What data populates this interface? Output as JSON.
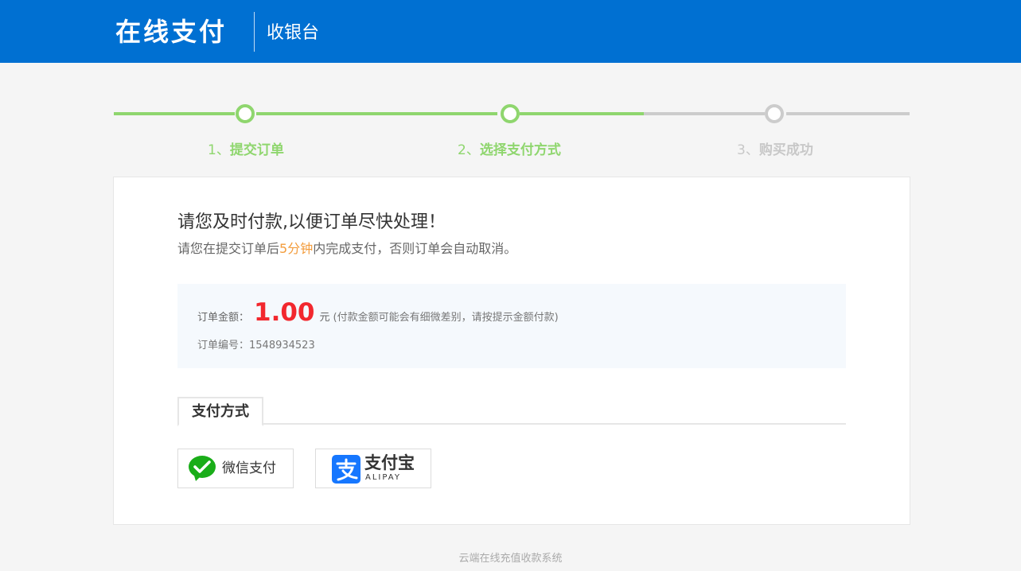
{
  "header": {
    "brand": "在线支付",
    "subtitle": "收银台"
  },
  "steps": [
    {
      "num": "1、",
      "label": "提交订单",
      "state": "done"
    },
    {
      "num": "2、",
      "label": "选择支付方式",
      "state": "done"
    },
    {
      "num": "3、",
      "label": "购买成功",
      "state": "pending"
    }
  ],
  "notice": {
    "title": "请您及时付款,以便订单尽快处理！",
    "sub_before": "请您在提交订单后",
    "sub_highlight": "5分钟",
    "sub_after": "内完成支付，否则订单会自动取消。"
  },
  "order": {
    "amount_label": "订单金额：",
    "amount_value": "1.00",
    "amount_unit": "元",
    "amount_note": "(付款金额可能会有细微差别，请按提示金额付款)",
    "number_label": "订单编号：",
    "number_value": "1548934523"
  },
  "payment": {
    "tab_label": "支付方式",
    "options": [
      {
        "label": "微信支付",
        "icon": "wechat-pay-icon"
      },
      {
        "label": "支付宝",
        "sublabel": "ALIPAY",
        "icon": "alipay-icon"
      }
    ]
  },
  "footer": {
    "text": "云端在线充值收款系统"
  },
  "colors": {
    "header_bg": "#0070d2",
    "step_done": "#8fd66e",
    "step_pending": "#cccccc",
    "amount": "#f2282e",
    "highlight": "#f39c3c",
    "wechat_green": "#1aad19",
    "alipay_blue": "#1677ff"
  }
}
